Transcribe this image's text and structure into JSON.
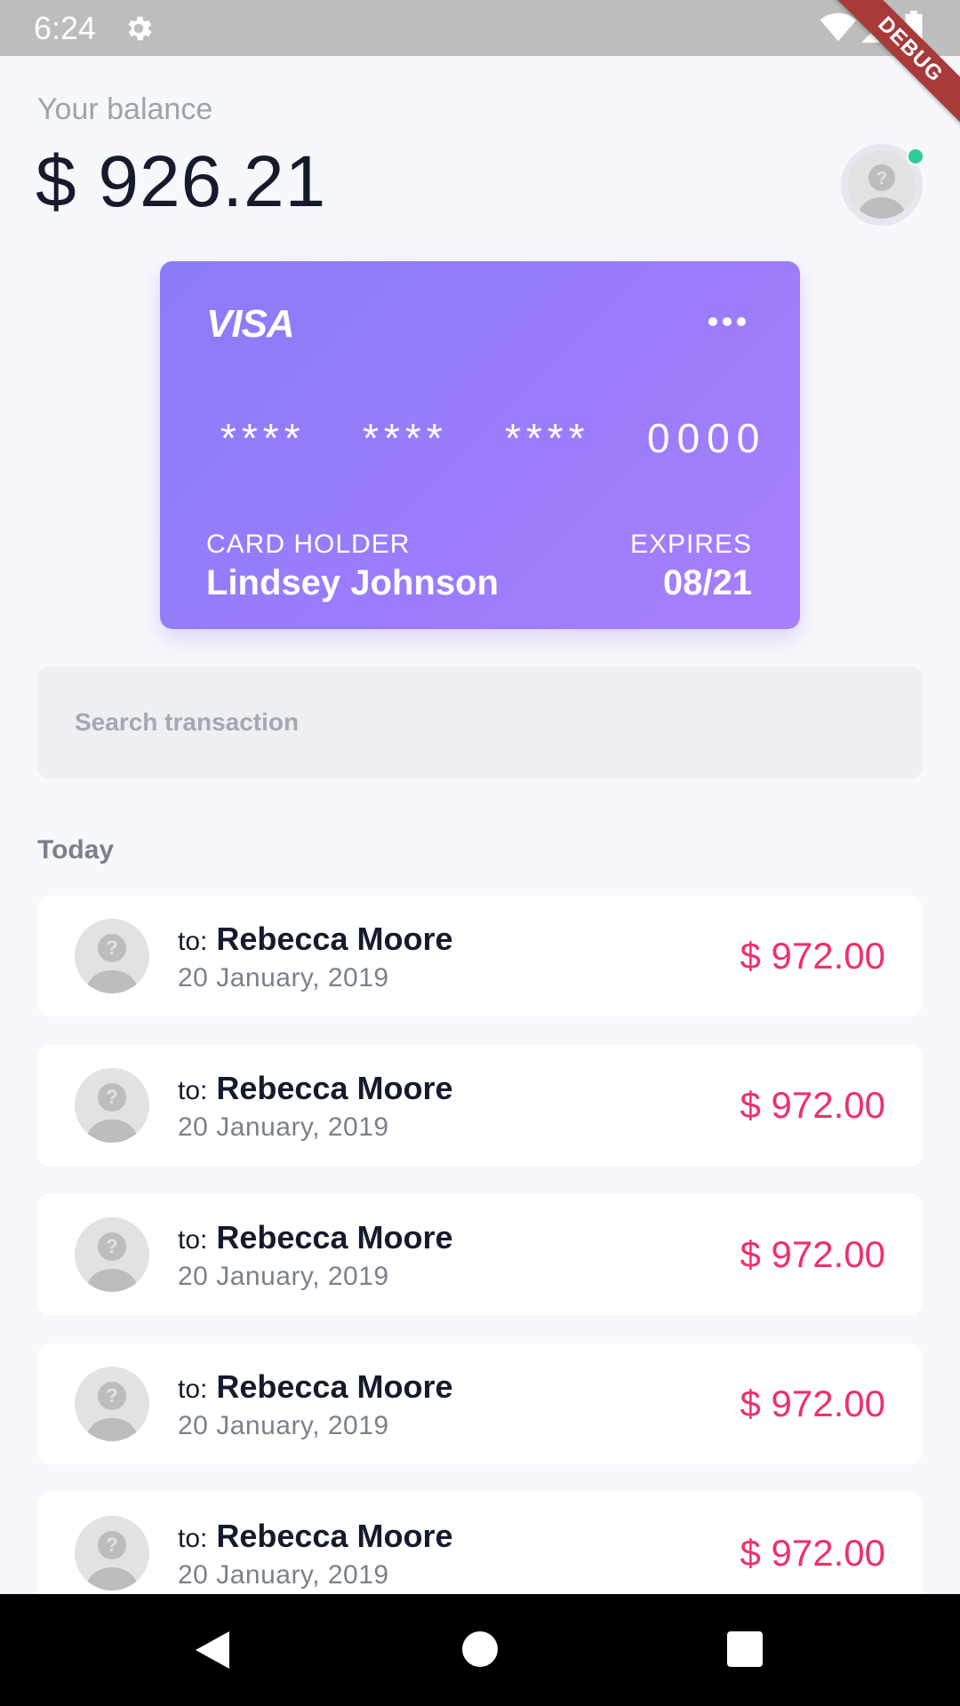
{
  "status_bar": {
    "time": "6:24",
    "debug_label": "DEBUG"
  },
  "balance": {
    "label": "Your balance",
    "amount": "$ 926.21"
  },
  "card": {
    "brand": "VISA",
    "number_groups": [
      "****",
      "****",
      "****",
      "0000"
    ],
    "holder_label": "CARD HOLDER",
    "holder_name": "Lindsey Johnson",
    "expires_label": "EXPIRES",
    "expires_value": "08/21",
    "gradient_start": "#8b7bf8",
    "gradient_end": "#a87ffd"
  },
  "search": {
    "placeholder": "Search transaction"
  },
  "section": {
    "title": "Today"
  },
  "transactions": [
    {
      "prefix": "to:",
      "name": "Rebecca Moore",
      "date": "20 January, 2019",
      "amount": "$ 972.00"
    },
    {
      "prefix": "to:",
      "name": "Rebecca Moore",
      "date": "20 January, 2019",
      "amount": "$ 972.00"
    },
    {
      "prefix": "to:",
      "name": "Rebecca Moore",
      "date": "20 January, 2019",
      "amount": "$ 972.00"
    },
    {
      "prefix": "to:",
      "name": "Rebecca Moore",
      "date": "20 January, 2019",
      "amount": "$ 972.00"
    },
    {
      "prefix": "to:",
      "name": "Rebecca Moore",
      "date": "20 January, 2019",
      "amount": "$ 972.00"
    }
  ],
  "colors": {
    "amount": "#f0306a",
    "online": "#2ecc97",
    "text_primary": "#151a2d",
    "text_secondary": "#7b808c"
  },
  "icons": {
    "settings": "gear-icon",
    "wifi": "wifi-icon",
    "signal": "signal-icon",
    "battery": "battery-icon",
    "card_menu": "more-horizontal-icon",
    "avatar": "default-avatar-icon",
    "nav_back": "back-triangle-icon",
    "nav_home": "home-circle-icon",
    "nav_recents": "recents-square-icon"
  }
}
